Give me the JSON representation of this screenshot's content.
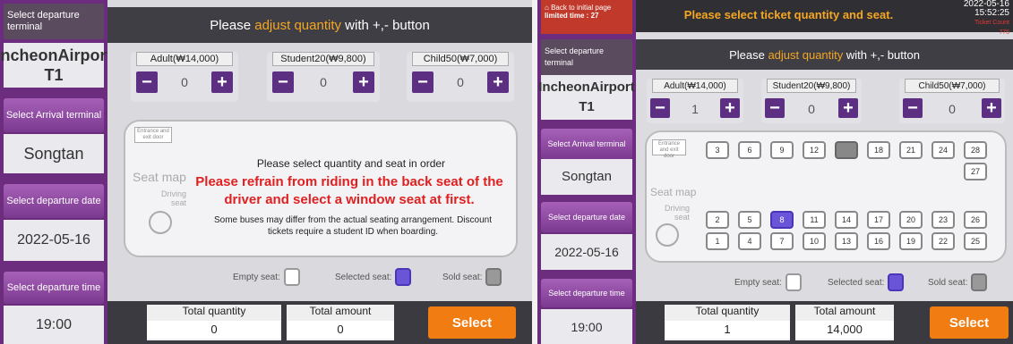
{
  "left": {
    "sidebar": {
      "departure_terminal_label": "Select departure terminal",
      "departure_terminal_value": "IncheonAirport T1",
      "arrival_terminal_label": "Select Arrival terminal",
      "arrival_terminal_value": "Songtan",
      "departure_date_label": "Select departure date",
      "departure_date_value": "2022-05-16",
      "departure_time_label": "Select departure time",
      "departure_time_value": "19:00"
    },
    "instruction_prefix": "Please",
    "instruction_highlight": "adjust quantity",
    "instruction_suffix": "with +,- button",
    "tickets": [
      {
        "label": "Adult(₩14,000)",
        "qty": "0"
      },
      {
        "label": "Student20(₩9,800)",
        "qty": "0"
      },
      {
        "label": "Child50(₩7,000)",
        "qty": "0"
      }
    ],
    "minus": "−",
    "plus": "+",
    "entrance_label": "Entrance and exit door",
    "seat_map_label": "Seat map",
    "driving_seat_label": "Driving seat",
    "msg_main": "Please select quantity and seat in order",
    "msg_warning": "Please refrain from riding in the back seat of the driver and select a window seat at first.",
    "msg_note": "Some buses may differ from the actual seating arrangement. Discount tickets require a student ID when boarding.",
    "legend_empty": "Empty seat:",
    "legend_selected": "Selected seat:",
    "legend_sold": "Sold seat:",
    "total_quantity_label": "Total quantity",
    "total_quantity_value": "0",
    "total_amount_label": "Total amount",
    "total_amount_value": "0",
    "select_button": "Select"
  },
  "right": {
    "back_button": "Back to initial page",
    "limited_time": "limited time : 27",
    "header_msg": "Please select ticket quantity and seat.",
    "date": "2022-05-16",
    "time": "15:52:25",
    "ticket_count_label": "Ticket Count",
    "ticket_count_value": "775",
    "sidebar": {
      "departure_terminal_label": "Select departure terminal",
      "departure_terminal_value": "IncheonAirport T1",
      "arrival_terminal_label": "Select Arrival terminal",
      "arrival_terminal_value": "Songtan",
      "departure_date_label": "Select departure date",
      "departure_date_value": "2022-05-16",
      "departure_time_label": "Select departure time",
      "departure_time_value": "19:00"
    },
    "instruction_prefix": "Please",
    "instruction_highlight": "adjust quantity",
    "instruction_suffix": "with +,- button",
    "tickets": [
      {
        "label": "Adult(₩14,000)",
        "qty": "1"
      },
      {
        "label": "Student20(₩9,800)",
        "qty": "0"
      },
      {
        "label": "Child50(₩7,000)",
        "qty": "0"
      }
    ],
    "minus": "−",
    "plus": "+",
    "entrance_label": "Entrance and exit door",
    "seat_map_label": "Seat map",
    "driving_seat_label": "Driving seat",
    "seats_top": [
      "3",
      "6",
      "9",
      "12",
      "15",
      "18",
      "21",
      "24",
      "28"
    ],
    "seat_27": "27",
    "seats_mid": [
      "2",
      "5",
      "8",
      "11",
      "14",
      "17",
      "20",
      "23",
      "26"
    ],
    "seats_bot": [
      "1",
      "4",
      "7",
      "10",
      "13",
      "16",
      "19",
      "22",
      "25"
    ],
    "selected_seat": "8",
    "sold_seat": "15",
    "legend_empty": "Empty seat:",
    "legend_selected": "Selected seat:",
    "legend_sold": "Sold seat:",
    "total_quantity_label": "Total quantity",
    "total_quantity_value": "1",
    "total_amount_label": "Total amount",
    "total_amount_value": "14,000",
    "select_button": "Select"
  }
}
